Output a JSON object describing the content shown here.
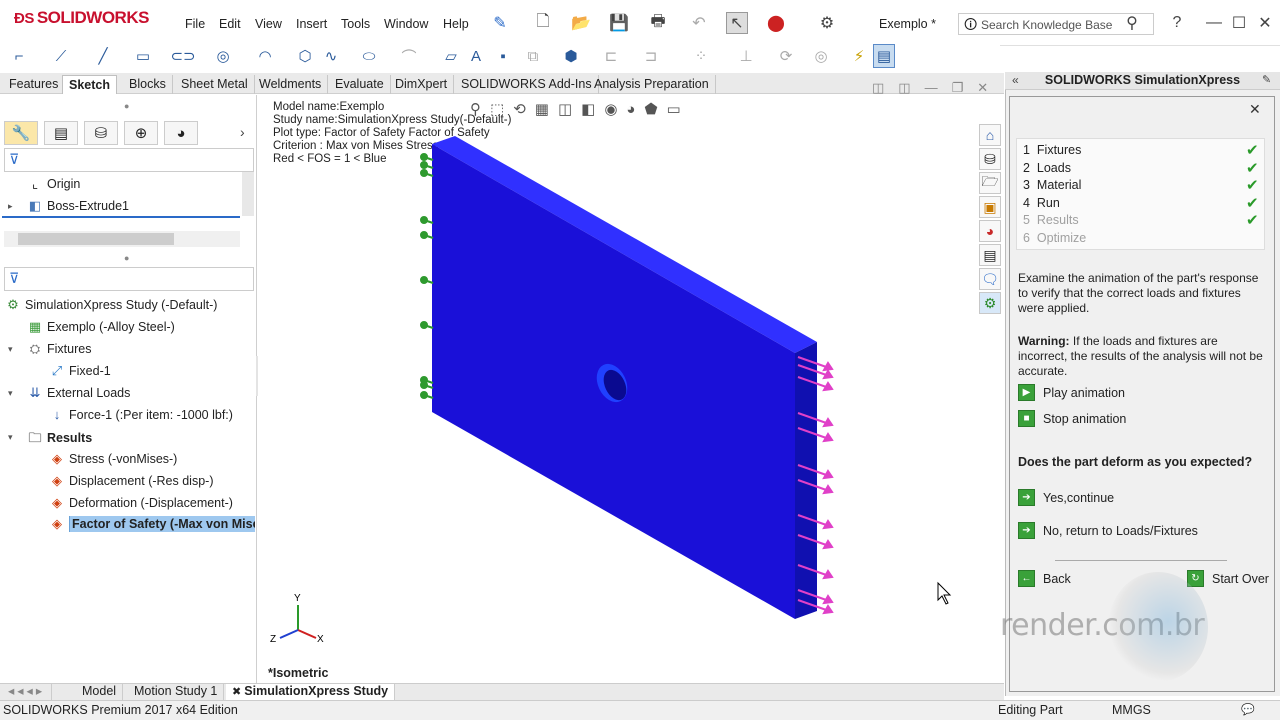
{
  "app": {
    "logo_text": "SOLIDWORKS",
    "menu": [
      "File",
      "Edit",
      "View",
      "Insert",
      "Tools",
      "Window",
      "Help"
    ],
    "document_title": "Exemplo *",
    "search_placeholder": "Search Knowledge Base"
  },
  "command_tabs": [
    "Features",
    "Sketch",
    "Blocks",
    "Sheet Metal",
    "Weldments",
    "Evaluate",
    "DimXpert",
    "SOLIDWORKS Add-Ins",
    "Analysis Preparation"
  ],
  "feature_tree": {
    "origin": "Origin",
    "boss": "Boss-Extrude1"
  },
  "study_tree": {
    "study": "SimulationXpress Study (-Default-)",
    "part": "Exemplo (-Alloy Steel-)",
    "fixtures": "Fixtures",
    "fixed": "Fixed-1",
    "external_loads": "External Loads",
    "force": "Force-1 (:Per item: -1000 lbf:)",
    "results": "Results",
    "stress": "Stress (-vonMises-)",
    "displacement": "Displacement (-Res disp-)",
    "deformation": "Deformation (-Displacement-)",
    "fos": "Factor of Safety (-Max von Mises"
  },
  "viewport": {
    "model_name": "Model name:Exemplo",
    "study_name": "Study name:SimulationXpress Study(-Default-)",
    "plot_type": "Plot type: Factor of Safety Factor of Safety",
    "criterion": "Criterion : Max von Mises Stress",
    "legend": "Red <  FOS = 1 < Blue",
    "view_label": "*Isometric",
    "axis_x": "X",
    "axis_y": "Y",
    "axis_z": "Z"
  },
  "sim_panel": {
    "title": "SOLIDWORKS SimulationXpress",
    "steps": [
      {
        "num": "1",
        "label": "Fixtures",
        "done": true
      },
      {
        "num": "2",
        "label": "Loads",
        "done": true
      },
      {
        "num": "3",
        "label": "Material",
        "done": true
      },
      {
        "num": "4",
        "label": "Run",
        "done": true
      },
      {
        "num": "5",
        "label": "Results",
        "done": true
      },
      {
        "num": "6",
        "label": "Optimize",
        "done": false
      }
    ],
    "examine_text": "Examine the animation of the part's response to verify that the correct loads and fixtures were applied.",
    "warning_label": "Warning:",
    "warning_text": " If the loads and fixtures are incorrect, the results of the analysis will not be accurate.",
    "play": "Play animation",
    "stop": "Stop animation",
    "question": "Does the part deform as you expected?",
    "yes": "Yes,continue",
    "no": "No, return to Loads/Fixtures",
    "back": "Back",
    "start_over": "Start Over"
  },
  "bottom_tabs": [
    "Model",
    "Motion Study 1",
    "SimulationXpress Study"
  ],
  "status": {
    "edition": "SOLIDWORKS Premium 2017 x64 Edition",
    "mode": "Editing Part",
    "units": "MMGS"
  },
  "watermark": "render.com.br",
  "colors": {
    "part_blue": "#1a10d8",
    "load_arrow": "#e040c8",
    "fixture_green": "#2e9a2e",
    "brand_red": "#c8102e"
  }
}
